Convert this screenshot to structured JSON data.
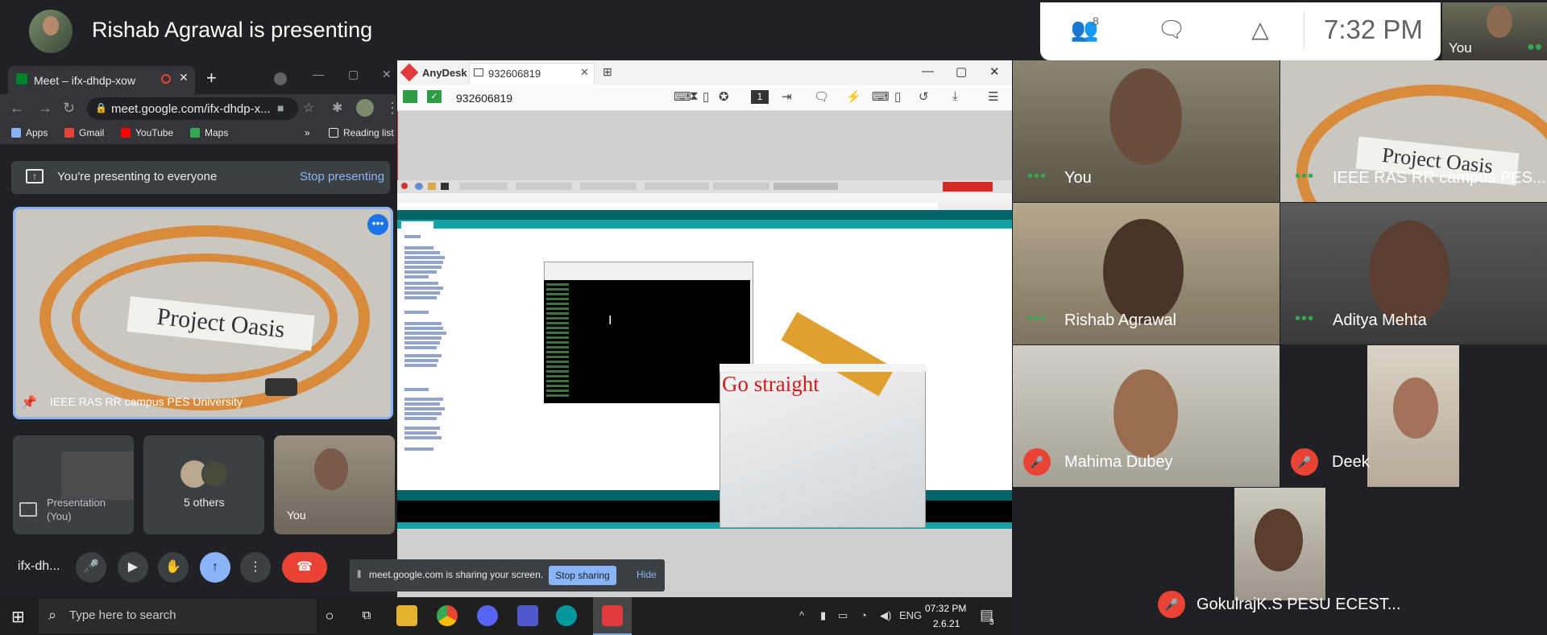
{
  "presenter": {
    "title": "Rishab Agrawal is presenting"
  },
  "controls": {
    "people_count": "8",
    "time": "7:32 PM",
    "self_label": "You",
    "people_icon": "people-icon",
    "chat_icon": "chat-icon",
    "activities_icon": "activities-icon"
  },
  "chrome": {
    "tab_title": "Meet – ifx-dhdp-xow",
    "url": "meet.google.com/ifx-dhdp-x...",
    "bookmarks": [
      "Apps",
      "Gmail",
      "YouTube",
      "Maps"
    ],
    "more_bookmarks": "»",
    "reading_list": "Reading list"
  },
  "meet": {
    "presenting_text": "You're presenting to everyone",
    "stop_presenting": "Stop presenting",
    "main_tile_name": "IEEE RAS RR campus PES University",
    "main_tile_banner": "Project Oasis",
    "mini_presentation": "Presentation (You)",
    "mini_others": "5 others",
    "mini_you": "You",
    "meeting_code": "ifx-dh..."
  },
  "anydesk": {
    "app_name": "AnyDesk",
    "tab_id": "932606819",
    "address_id": "932606819",
    "monitor_number": "1",
    "overlay_text": "Go straight"
  },
  "share_bar": {
    "text": "meet.google.com is sharing your screen.",
    "stop": "Stop sharing",
    "hide": "Hide"
  },
  "participants": [
    {
      "name": "You",
      "muted": false
    },
    {
      "name": "IEEE RAS RR campus PES...",
      "muted": false
    },
    {
      "name": "Rishab Agrawal",
      "muted": false
    },
    {
      "name": "Aditya Mehta",
      "muted": false
    },
    {
      "name": "Mahima Dubey",
      "muted": true
    },
    {
      "name": "Deek",
      "muted": true
    },
    {
      "name": "GokulrajK.S PESU ECEST...",
      "muted": true
    }
  ],
  "taskbar": {
    "search_placeholder": "Type here to search",
    "language": "ENG",
    "time": "07:32 PM",
    "date": "2.6.21",
    "notifications": "3"
  },
  "colors": {
    "accent": "#8ab4f8",
    "leave": "#ea4335",
    "active_mic": "#34a853",
    "anydesk": "#e0393e"
  }
}
